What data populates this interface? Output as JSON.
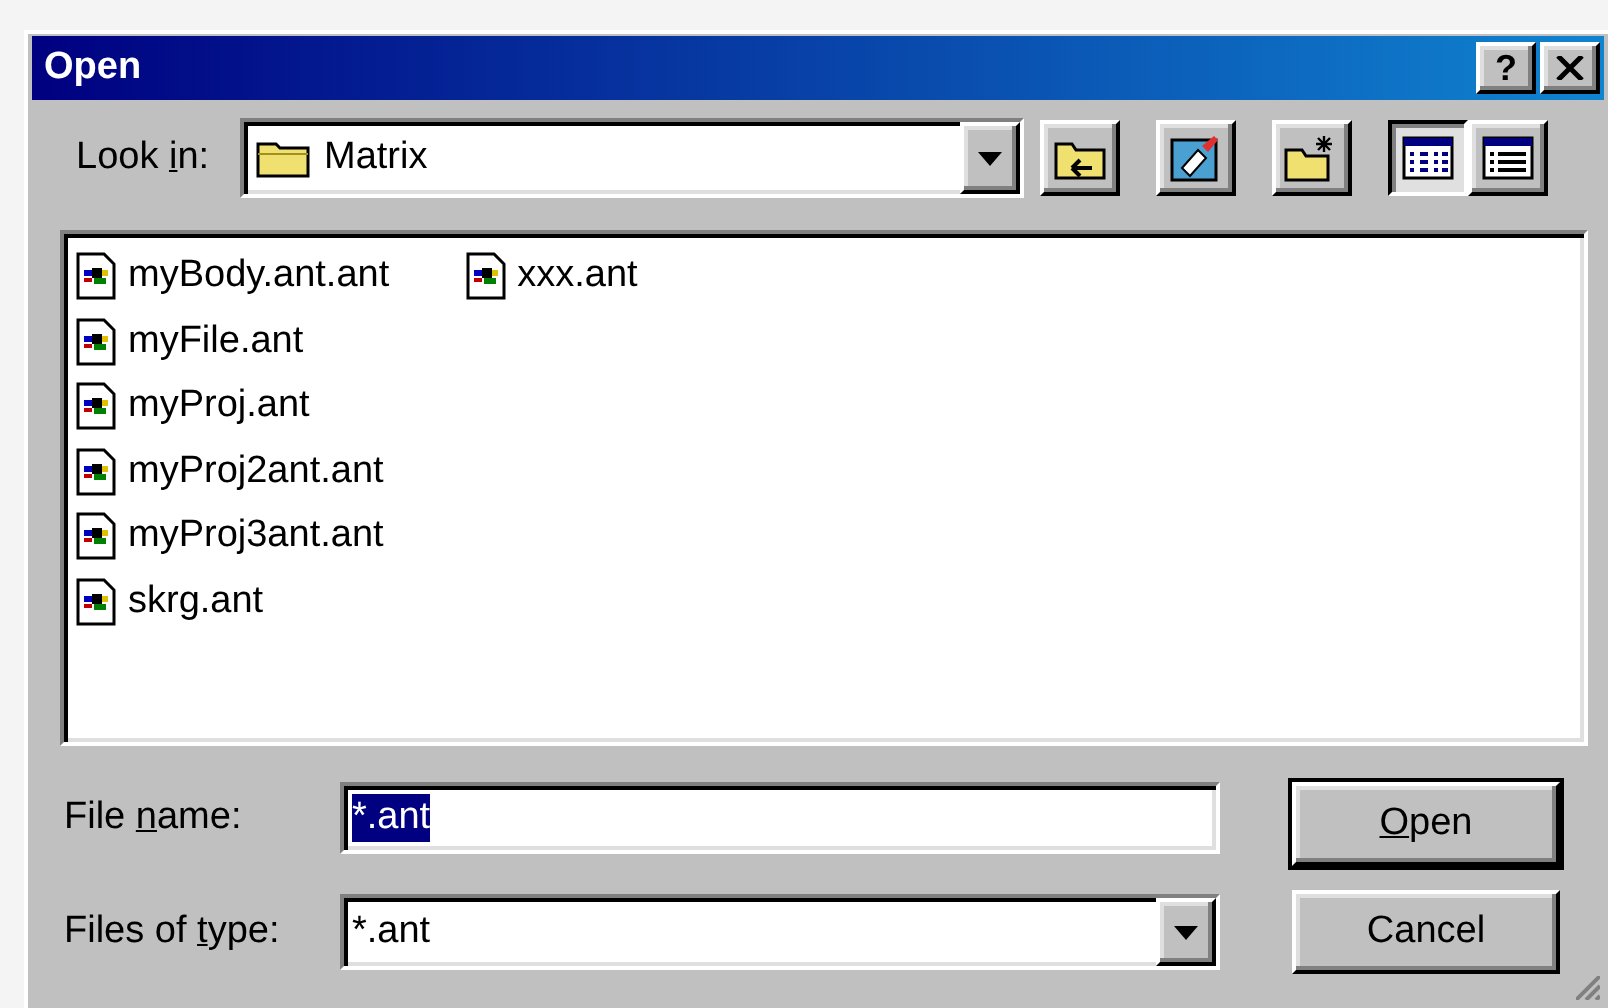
{
  "window": {
    "title": "Open",
    "title_buttons": [
      {
        "kind": "help",
        "label": "?"
      },
      {
        "kind": "close"
      }
    ]
  },
  "look_in": {
    "label": {
      "before": "Look ",
      "key": "i",
      "after": "n:"
    },
    "value": "Matrix"
  },
  "toolbar": [
    {
      "kind": "up-folder",
      "selected": false
    },
    {
      "kind": "desktop",
      "selected": false
    },
    {
      "kind": "new-folder",
      "selected": false
    },
    {
      "kind": "list-view",
      "selected": true
    },
    {
      "kind": "details-view",
      "selected": false
    }
  ],
  "files": [
    {
      "name": "myBody.ant.ant"
    },
    {
      "name": "myFile.ant"
    },
    {
      "name": "myProj.ant"
    },
    {
      "name": "myProj2ant.ant"
    },
    {
      "name": "myProj3ant.ant"
    },
    {
      "name": "skrg.ant"
    },
    {
      "name": "xxx.ant"
    }
  ],
  "file_name": {
    "label": {
      "before": "File ",
      "key": "n",
      "after": "ame:"
    },
    "value": "*.ant",
    "selected": true
  },
  "files_of_type": {
    "label": {
      "before": "Files of ",
      "key": "t",
      "after": "ype:"
    },
    "value": "*.ant"
  },
  "buttons": [
    {
      "label": {
        "key": "O",
        "after": "pen"
      },
      "default": true
    },
    {
      "label": {
        "before": "Cancel"
      },
      "default": false
    }
  ]
}
